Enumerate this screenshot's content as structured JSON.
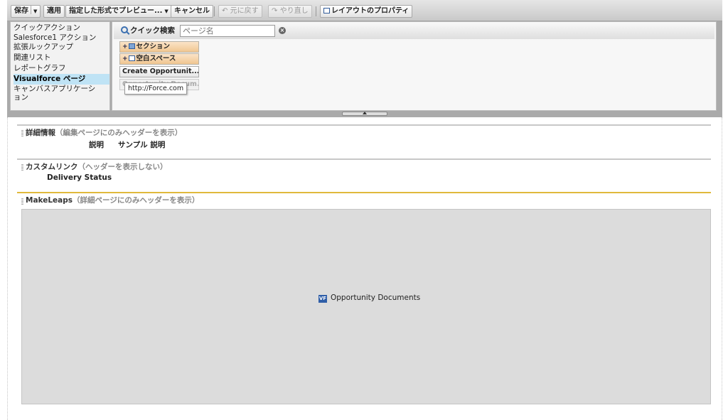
{
  "toolbar": {
    "save": "保存",
    "apply": "適用",
    "preview": "指定した形式でプレビュー...",
    "cancel": "キャンセル",
    "undo": "元に戻す",
    "redo": "やり直し",
    "layout_properties": "レイアウトのプロパティ"
  },
  "categories": [
    "クイックアクション",
    "Salesforce1 アクション",
    "拡張ルックアップ",
    "関連リスト",
    "レポートグラフ",
    "Visualforce ページ",
    "キャンバスアプリケーシ",
    "ョン"
  ],
  "selected_category": "Visualforce ページ",
  "quick_search": {
    "label": "クイック検索",
    "placeholder": "ページ名"
  },
  "palette_items": {
    "section": "セクション",
    "blank_space": "空白スペース",
    "create_opportunity": "Create Opportunit...",
    "opportunity_documents": "Opportunity Docum..."
  },
  "tooltip": "http://Force.com",
  "sections": [
    {
      "title": "詳細情報",
      "note": "（編集ページにのみヘッダーを表示）",
      "field_label": "説明",
      "field_value": "サンプル 説明"
    },
    {
      "title": "カスタムリンク",
      "note": "（ヘッダーを表示しない）",
      "link": "Delivery Status"
    },
    {
      "title": "MakeLeaps",
      "note": "（詳細ページにのみヘッダーを表示）",
      "component_icon": "VF",
      "component": "Opportunity Documents"
    }
  ],
  "colors": {
    "selected_category_bg": "#bfe3f5",
    "section_item_orange": "#f0c690",
    "makeleaps_divider": "#e0b93c",
    "vf_component_bg": "#dcdcdc"
  }
}
